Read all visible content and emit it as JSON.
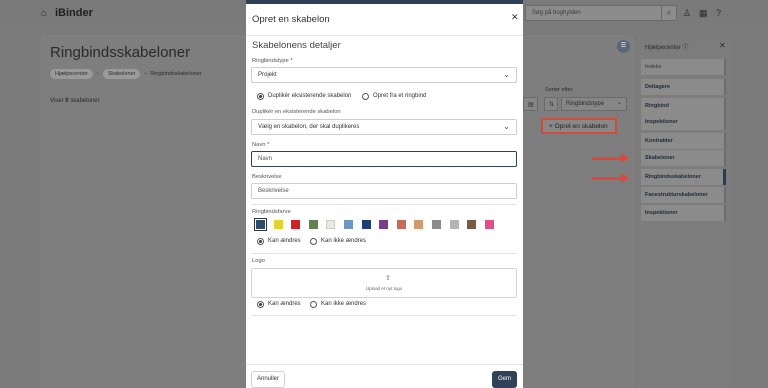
{
  "topbar": {
    "logo": "iBinder",
    "search_placeholder": "Søg på boghylden"
  },
  "page": {
    "title": "Ringbindsskabeloner",
    "breadcrumbs": [
      "Hjælpecenter",
      "Skabeloner",
      "Ringbindsskabeloner"
    ],
    "count_prefix": "Viser ",
    "count": "0",
    "count_suffix": " skabeloner",
    "sort_label": "Sorter efter",
    "sort_value": "Ringbindstype",
    "create_button": "Opret en skabelon"
  },
  "help": {
    "title": "Hjælpecenter",
    "items": [
      {
        "label": "Indeks"
      },
      {
        "label": "Deltagere"
      },
      {
        "label": "Ringbind"
      },
      {
        "label": "Inspektioner"
      },
      {
        "label": "Kontrakter"
      },
      {
        "label": "Skabeloner"
      },
      {
        "label": "Ringbindsskabeloner"
      },
      {
        "label": "Fanestrukturskabeloner"
      },
      {
        "label": "Inspektioner"
      }
    ]
  },
  "modal": {
    "title": "Opret en skabelon",
    "section": "Skabelonens detaljer",
    "binder_type_label": "Ringbindstype *",
    "binder_type_value": "Projekt",
    "radio_duplicate": "Duplikér eksisterende skabelon",
    "radio_create": "Opret fra et ringbind",
    "duplicate_label": "Duplikér en eksisterende skabelon",
    "duplicate_value": "Vælg en skabelon, der skal duplikeres",
    "name_label": "Navn *",
    "name_placeholder": "Navn",
    "desc_label": "Beskrivelse",
    "desc_placeholder": "Beskrivelse",
    "color_label": "Ringbindsfarve",
    "colors": [
      "#2f4a6b",
      "#e3d32e",
      "#d71f26",
      "#5f8451",
      "#ece9dc",
      "#6d95c5",
      "#1f3e7a",
      "#7b3b8e",
      "#c9695a",
      "#d39a6e",
      "#8b8b8b",
      "#b4b4b4",
      "#7a5a42",
      "#e64b8c"
    ],
    "can_change": "Kan ændres",
    "cannot_change": "Kan ikke ændres",
    "logo_label": "Logo",
    "upload_text": "Upload et nyt logo",
    "cancel": "Annuller",
    "save": "Gem"
  }
}
